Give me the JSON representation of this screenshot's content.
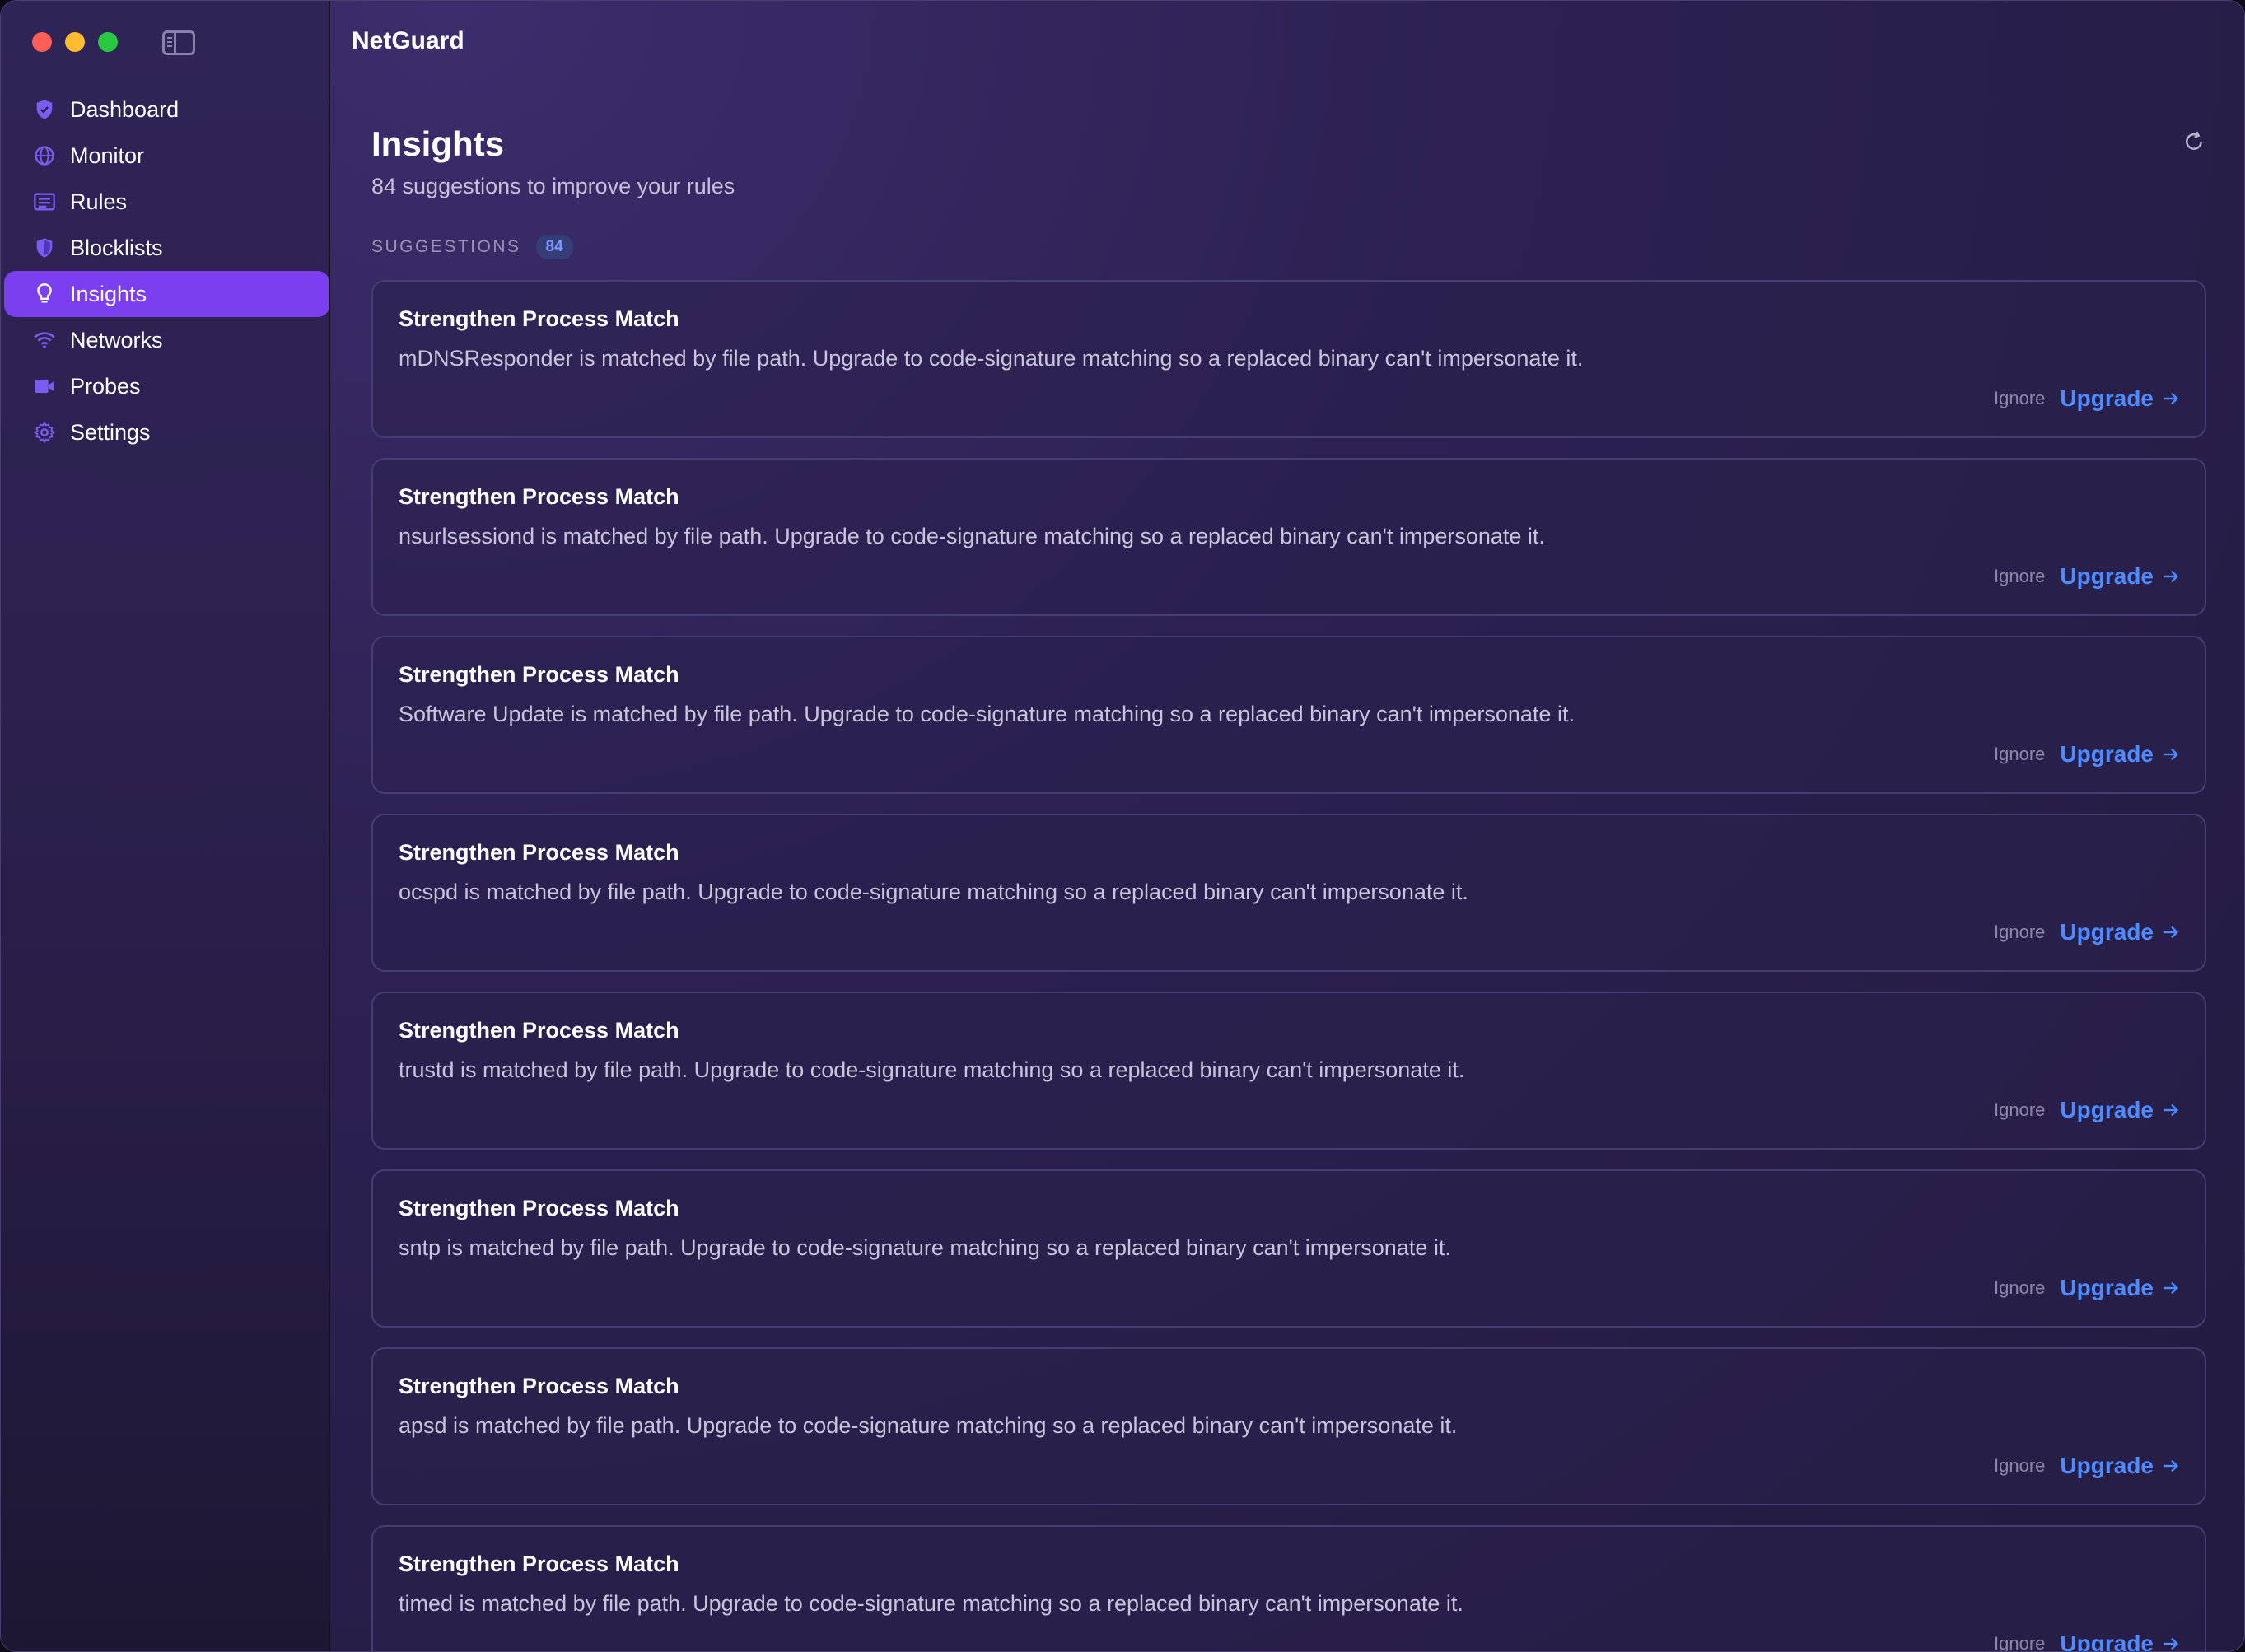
{
  "app": {
    "title": "NetGuard"
  },
  "sidebar": {
    "items": [
      {
        "label": "Dashboard",
        "icon": "shield-check-icon",
        "active": false
      },
      {
        "label": "Monitor",
        "icon": "globe-icon",
        "active": false
      },
      {
        "label": "Rules",
        "icon": "list-icon",
        "active": false
      },
      {
        "label": "Blocklists",
        "icon": "shield-icon",
        "active": false
      },
      {
        "label": "Insights",
        "icon": "lightbulb-icon",
        "active": true
      },
      {
        "label": "Networks",
        "icon": "wifi-icon",
        "active": false
      },
      {
        "label": "Probes",
        "icon": "video-icon",
        "active": false
      },
      {
        "label": "Settings",
        "icon": "gear-icon",
        "active": false
      }
    ]
  },
  "page": {
    "title": "Insights",
    "subtitle": "84 suggestions to improve your rules"
  },
  "suggestions": {
    "label": "SUGGESTIONS",
    "count": "84",
    "cards": [
      {
        "title": "Strengthen Process Match",
        "description": "mDNSResponder is matched by file path. Upgrade to code-signature matching so a replaced binary can't impersonate it.",
        "ignore": "Ignore",
        "upgrade": "Upgrade"
      },
      {
        "title": "Strengthen Process Match",
        "description": "nsurlsessiond is matched by file path. Upgrade to code-signature matching so a replaced binary can't impersonate it.",
        "ignore": "Ignore",
        "upgrade": "Upgrade"
      },
      {
        "title": "Strengthen Process Match",
        "description": "Software Update is matched by file path. Upgrade to code-signature matching so a replaced binary can't impersonate it.",
        "ignore": "Ignore",
        "upgrade": "Upgrade"
      },
      {
        "title": "Strengthen Process Match",
        "description": "ocspd is matched by file path. Upgrade to code-signature matching so a replaced binary can't impersonate it.",
        "ignore": "Ignore",
        "upgrade": "Upgrade"
      },
      {
        "title": "Strengthen Process Match",
        "description": "trustd is matched by file path. Upgrade to code-signature matching so a replaced binary can't impersonate it.",
        "ignore": "Ignore",
        "upgrade": "Upgrade"
      },
      {
        "title": "Strengthen Process Match",
        "description": "sntp is matched by file path. Upgrade to code-signature matching so a replaced binary can't impersonate it.",
        "ignore": "Ignore",
        "upgrade": "Upgrade"
      },
      {
        "title": "Strengthen Process Match",
        "description": "apsd is matched by file path. Upgrade to code-signature matching so a replaced binary can't impersonate it.",
        "ignore": "Ignore",
        "upgrade": "Upgrade"
      },
      {
        "title": "Strengthen Process Match",
        "description": "timed is matched by file path. Upgrade to code-signature matching so a replaced binary can't impersonate it.",
        "ignore": "Ignore",
        "upgrade": "Upgrade"
      }
    ]
  },
  "colors": {
    "accent": "#7b3ff0",
    "link": "#4d8bff",
    "icon": "#7a5cf0"
  }
}
